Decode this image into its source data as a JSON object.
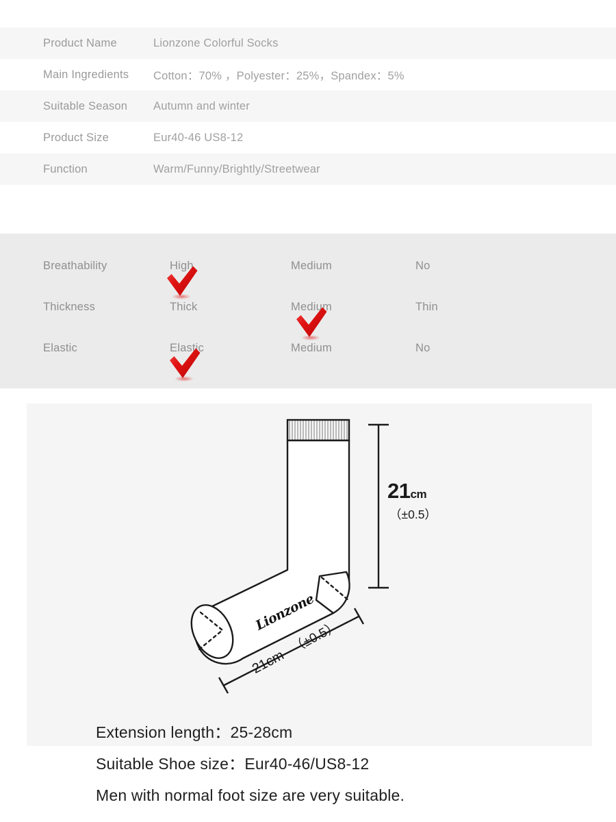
{
  "spec_table": {
    "rows": [
      {
        "label": "Product Name",
        "value": "Lionzone Colorful Socks"
      },
      {
        "label": "Main Ingredients",
        "value": "Cotton：70% ，Polyester：25%，Spandex：5%"
      },
      {
        "label": "Suitable Season",
        "value": "Autumn and winter"
      },
      {
        "label": "Product Size",
        "value": "Eur40-46 US8-12"
      },
      {
        "label": "Function",
        "value": "Warm/Funny/Brightly/Streetwear"
      }
    ]
  },
  "properties": {
    "rows": [
      {
        "label": "Breathability",
        "options": [
          "High",
          "Medium",
          "No"
        ],
        "selected_index": 0
      },
      {
        "label": "Thickness",
        "options": [
          "Thick",
          "Medium",
          "Thin"
        ],
        "selected_index": 1
      },
      {
        "label": "Elastic",
        "options": [
          "Elastic",
          "Medium",
          "No"
        ],
        "selected_index": 0
      }
    ],
    "check_icon": "red-check-mark"
  },
  "diagram": {
    "brand_text": "Lionzone",
    "vertical_dimension": {
      "value": "21",
      "unit": "cm",
      "tolerance": "（±0.5）"
    },
    "horizontal_dimension": {
      "value": "21cm",
      "tolerance": "（±0.5）"
    },
    "cuff_stripe_count": 25
  },
  "captions": [
    "Extension length：25-28cm",
    "Suitable Shoe size：Eur40-46/US8-12",
    "Men with normal foot size are very suitable."
  ],
  "colors": {
    "row_odd": "#f6f6f6",
    "row_even": "#ffffff",
    "props_panel": "#ebebeb",
    "diagram_card": "#f5f5f5",
    "check_red": "#e11313",
    "label_gray": "#9a9a9a",
    "ink": "#1b1b1b"
  }
}
